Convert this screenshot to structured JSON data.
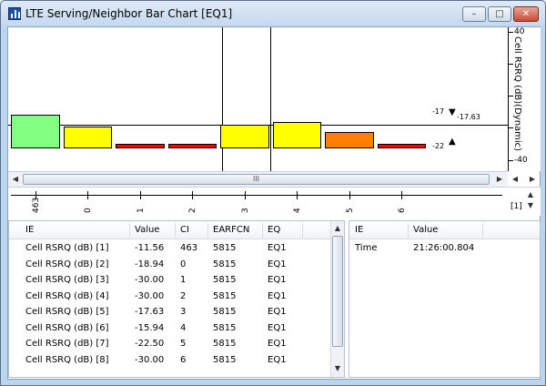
{
  "window": {
    "title": "LTE Serving/Neighbor Bar Chart [EQ1]",
    "controls": [
      "minimize",
      "maximize",
      "close"
    ],
    "icons": {
      "minimize": "–",
      "maximize": "□",
      "close": "✕"
    }
  },
  "chart": {
    "axis_title": "Cell RSRQ (dB)(Dynamic)",
    "y_ticks": [
      "40",
      "-40"
    ],
    "marker_top_label": "-17",
    "marker_value_label": "-17.63",
    "marker_bottom_label": "-22",
    "scroll_thumb_label": "III",
    "x_tick_labels": [
      "463",
      "0",
      "1",
      "2",
      "3",
      "4",
      "5",
      "6"
    ],
    "page_indicator": "[1]",
    "colors": {
      "green": "#80ff80",
      "yellow": "#ffff00",
      "red": "#ff0000",
      "orange": "#ff8000"
    }
  },
  "chart_data": {
    "type": "bar",
    "categories": [
      "463",
      "0",
      "1",
      "2",
      "3",
      "4",
      "5",
      "6"
    ],
    "values": [
      -11.56,
      -18.94,
      -30.0,
      -30.0,
      -17.63,
      -15.94,
      -22.5,
      -30.0
    ],
    "bar_colors": [
      "#80ff80",
      "#ffff00",
      "#ff0000",
      "#ff0000",
      "#ffff00",
      "#ffff00",
      "#ff8000",
      "#ff0000"
    ],
    "ylabel": "Cell RSRQ (dB)(Dynamic)",
    "ylim": [
      -40,
      40
    ],
    "reference_line": -17.63,
    "grid": false
  },
  "left_table": {
    "headers": [
      "IE",
      "Value",
      "CI",
      "EARFCN",
      "EQ"
    ],
    "rows": [
      [
        "Cell RSRQ (dB) [1]",
        "-11.56",
        "463",
        "5815",
        "EQ1"
      ],
      [
        "Cell RSRQ (dB) [2]",
        "-18.94",
        "0",
        "5815",
        "EQ1"
      ],
      [
        "Cell RSRQ (dB) [3]",
        "-30.00",
        "1",
        "5815",
        "EQ1"
      ],
      [
        "Cell RSRQ (dB) [4]",
        "-30.00",
        "2",
        "5815",
        "EQ1"
      ],
      [
        "Cell RSRQ (dB) [5]",
        "-17.63",
        "3",
        "5815",
        "EQ1"
      ],
      [
        "Cell RSRQ (dB) [6]",
        "-15.94",
        "4",
        "5815",
        "EQ1"
      ],
      [
        "Cell RSRQ (dB) [7]",
        "-22.50",
        "5",
        "5815",
        "EQ1"
      ],
      [
        "Cell RSRQ (dB) [8]",
        "-30.00",
        "6",
        "5815",
        "EQ1"
      ]
    ]
  },
  "right_table": {
    "headers": [
      "IE",
      "Value"
    ],
    "rows": [
      [
        "Time",
        "21:26:00.804"
      ]
    ]
  }
}
